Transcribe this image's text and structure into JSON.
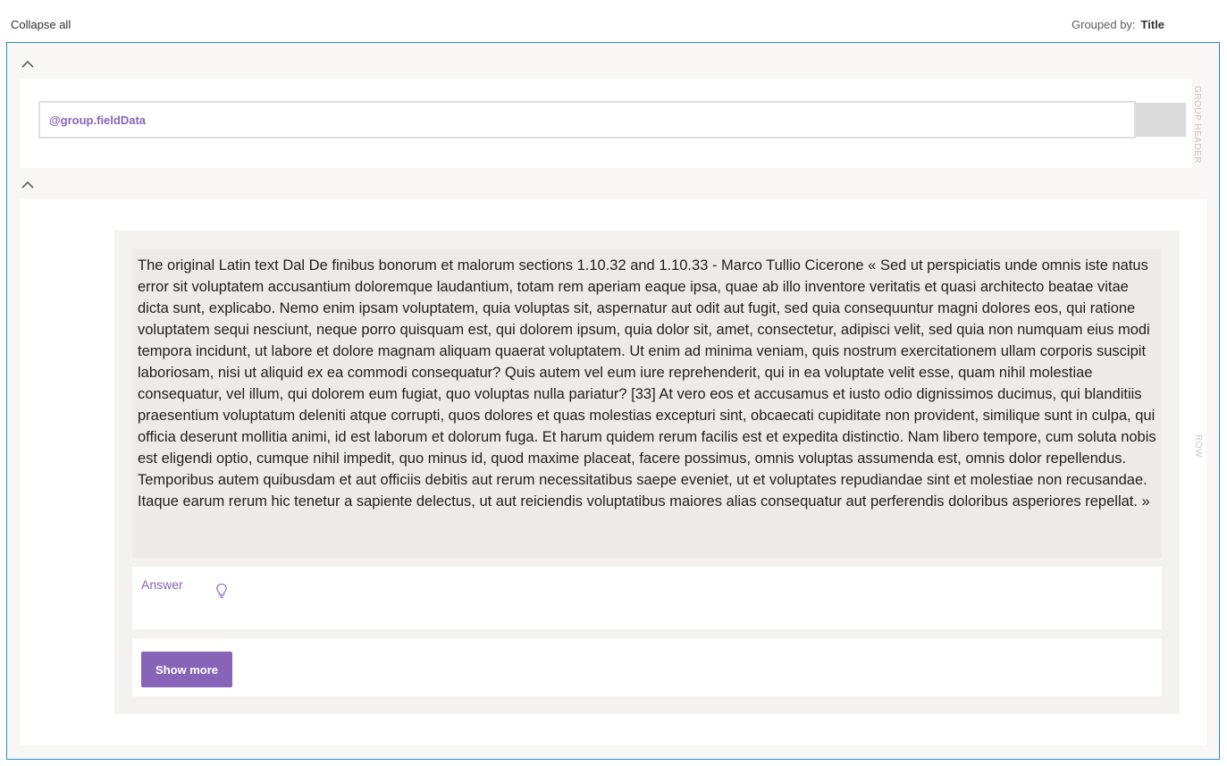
{
  "toolbar": {
    "collapse_all_label": "Collapse all",
    "grouped_by_label": "Grouped by:",
    "grouped_by_value": "Title"
  },
  "group_header": {
    "field_text": "@group.fieldData",
    "side_label": "GROUP HEADER"
  },
  "row": {
    "side_label": "ROW",
    "body_text": "The original Latin text Dal De finibus bonorum et malorum sections 1.10.32 and 1.10.33 - Marco Tullio Cicerone « Sed ut perspiciatis unde omnis iste natus error sit voluptatem accusantium doloremque laudantium, totam rem aperiam eaque ipsa, quae ab illo inventore veritatis et quasi architecto beatae vitae dicta sunt, explicabo. Nemo enim ipsam voluptatem, quia voluptas sit, aspernatur aut odit aut fugit, sed quia consequuntur magni dolores eos, qui ratione voluptatem sequi nesciunt, neque porro quisquam est, qui dolorem ipsum, quia dolor sit, amet, consectetur, adipisci velit, sed quia non numquam eius modi tempora incidunt, ut labore et dolore magnam aliquam quaerat voluptatem. Ut enim ad minima veniam, quis nostrum exercitationem ullam corporis suscipit laboriosam, nisi ut aliquid ex ea commodi consequatur? Quis autem vel eum iure reprehenderit, qui in ea voluptate velit esse, quam nihil molestiae consequatur, vel illum, qui dolorem eum fugiat, quo voluptas nulla pariatur? [33] At vero eos et accusamus et iusto odio dignissimos ducimus, qui blanditiis praesentium voluptatum deleniti atque corrupti, quos dolores et quas molestias excepturi sint, obcaecati cupiditate non provident, similique sunt in culpa, qui officia deserunt mollitia animi, id est laborum et dolorum fuga. Et harum quidem rerum facilis est et expedita distinctio. Nam libero tempore, cum soluta nobis est eligendi optio, cumque nihil impedit, quo minus id, quod maxime placeat, facere possimus, omnis voluptas assumenda est, omnis dolor repellendus. Temporibus autem quibusdam et aut officiis debitis aut rerum necessitatibus saepe eveniet, ut et voluptates repudiandae sint et molestiae non recusandae. Itaque earum rerum hic tenetur a sapiente delectus, ut aut reiciendis voluptatibus maiores alias consequatur aut perferendis doloribus asperiores repellat. »",
    "answer_label": "Answer",
    "answer_icon": "lightbulb-icon",
    "show_more_label": "Show more"
  },
  "colors": {
    "accent": "#8764b8",
    "outer_border": "#2a8dc8"
  }
}
